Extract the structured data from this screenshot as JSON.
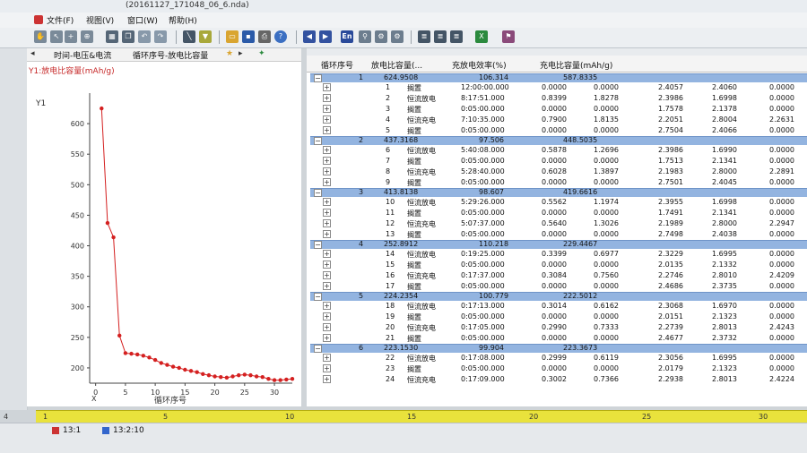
{
  "window": {
    "title": "(20161127_171048_06_6.nda)"
  },
  "menu": [
    "文件(F)",
    "视图(V)",
    "窗口(W)",
    "帮助(H)"
  ],
  "toolbar": {
    "en_label": "En"
  },
  "left_tabs": {
    "tab1": "时间-电压&电流",
    "tab2": "循环序号-放电比容量"
  },
  "chart_data": {
    "type": "scatter",
    "title": "Y1:放电比容量(mAh/g)",
    "ylabel": "Y1",
    "xlabel": "循环序号",
    "x_axis_letter": "X",
    "xticks": [
      0,
      5,
      10,
      15,
      20,
      25,
      30
    ],
    "yticks": [
      200,
      250,
      300,
      350,
      400,
      450,
      500,
      550,
      600
    ],
    "xlim": [
      -1,
      33
    ],
    "ylim": [
      175,
      650
    ],
    "series": [
      {
        "color": "#d42020",
        "x": [
          1,
          2,
          3,
          4,
          5,
          6,
          7,
          8,
          9,
          10,
          11,
          12,
          13,
          14,
          15,
          16,
          17,
          18,
          19,
          20,
          21,
          22,
          23,
          24,
          25,
          26,
          27,
          28,
          29,
          30,
          31,
          32,
          33
        ],
        "y": [
          624.9,
          437.3,
          413.8,
          252.9,
          224.2,
          223.2,
          222,
          220,
          217,
          213,
          208,
          205,
          202,
          200,
          197,
          195,
          193,
          190,
          188,
          186,
          185,
          184,
          186,
          188,
          189,
          188,
          186,
          185,
          182,
          180,
          180,
          181,
          182
        ]
      }
    ]
  },
  "table": {
    "headers": [
      "循环序号",
      "放电比容量(...",
      "充放电效率(%)",
      "充电比容量(mAh/g)"
    ],
    "cycles": [
      {
        "idx": "1",
        "cap": "624.9508",
        "eff": "106.314",
        "chg": "587.8335",
        "steps": [
          {
            "n": "1",
            "name": "搁置",
            "time": "12:00:00.000",
            "c1": "0.0000",
            "c2": "0.0000",
            "c3": "2.4057",
            "c4": "2.4060",
            "c5": "0.0000"
          },
          {
            "n": "2",
            "name": "恒流放电",
            "time": "8:17:51.000",
            "c1": "0.8399",
            "c2": "1.8278",
            "c3": "2.3986",
            "c4": "1.6998",
            "c5": "0.0000"
          },
          {
            "n": "3",
            "name": "搁置",
            "time": "0:05:00.000",
            "c1": "0.0000",
            "c2": "0.0000",
            "c3": "1.7578",
            "c4": "2.1378",
            "c5": "0.0000"
          },
          {
            "n": "4",
            "name": "恒流充电",
            "time": "7:10:35.000",
            "c1": "0.7900",
            "c2": "1.8135",
            "c3": "2.2051",
            "c4": "2.8004",
            "c5": "2.2631"
          },
          {
            "n": "5",
            "name": "搁置",
            "time": "0:05:00.000",
            "c1": "0.0000",
            "c2": "0.0000",
            "c3": "2.7504",
            "c4": "2.4066",
            "c5": "0.0000"
          }
        ]
      },
      {
        "idx": "2",
        "cap": "437.3168",
        "eff": "97.506",
        "chg": "448.5035",
        "steps": [
          {
            "n": "6",
            "name": "恒流放电",
            "time": "5:40:08.000",
            "c1": "0.5878",
            "c2": "1.2696",
            "c3": "2.3986",
            "c4": "1.6990",
            "c5": "0.0000"
          },
          {
            "n": "7",
            "name": "搁置",
            "time": "0:05:00.000",
            "c1": "0.0000",
            "c2": "0.0000",
            "c3": "1.7513",
            "c4": "2.1341",
            "c5": "0.0000"
          },
          {
            "n": "8",
            "name": "恒流充电",
            "time": "5:28:40.000",
            "c1": "0.6028",
            "c2": "1.3897",
            "c3": "2.1983",
            "c4": "2.8000",
            "c5": "2.2891"
          },
          {
            "n": "9",
            "name": "搁置",
            "time": "0:05:00.000",
            "c1": "0.0000",
            "c2": "0.0000",
            "c3": "2.7501",
            "c4": "2.4045",
            "c5": "0.0000"
          }
        ]
      },
      {
        "idx": "3",
        "cap": "413.8138",
        "eff": "98.607",
        "chg": "419.6616",
        "steps": [
          {
            "n": "10",
            "name": "恒流放电",
            "time": "5:29:26.000",
            "c1": "0.5562",
            "c2": "1.1974",
            "c3": "2.3955",
            "c4": "1.6998",
            "c5": "0.0000"
          },
          {
            "n": "11",
            "name": "搁置",
            "time": "0:05:00.000",
            "c1": "0.0000",
            "c2": "0.0000",
            "c3": "1.7491",
            "c4": "2.1341",
            "c5": "0.0000"
          },
          {
            "n": "12",
            "name": "恒流充电",
            "time": "5:07:37.000",
            "c1": "0.5640",
            "c2": "1.3026",
            "c3": "2.1989",
            "c4": "2.8000",
            "c5": "2.2947"
          },
          {
            "n": "13",
            "name": "搁置",
            "time": "0:05:00.000",
            "c1": "0.0000",
            "c2": "0.0000",
            "c3": "2.7498",
            "c4": "2.4038",
            "c5": "0.0000"
          }
        ]
      },
      {
        "idx": "4",
        "cap": "252.8912",
        "eff": "110.218",
        "chg": "229.4467",
        "steps": [
          {
            "n": "14",
            "name": "恒流放电",
            "time": "0:19:25.000",
            "c1": "0.3399",
            "c2": "0.6977",
            "c3": "2.3229",
            "c4": "1.6995",
            "c5": "0.0000"
          },
          {
            "n": "15",
            "name": "搁置",
            "time": "0:05:00.000",
            "c1": "0.0000",
            "c2": "0.0000",
            "c3": "2.0135",
            "c4": "2.1332",
            "c5": "0.0000"
          },
          {
            "n": "16",
            "name": "恒流充电",
            "time": "0:17:37.000",
            "c1": "0.3084",
            "c2": "0.7560",
            "c3": "2.2746",
            "c4": "2.8010",
            "c5": "2.4209"
          },
          {
            "n": "17",
            "name": "搁置",
            "time": "0:05:00.000",
            "c1": "0.0000",
            "c2": "0.0000",
            "c3": "2.4686",
            "c4": "2.3735",
            "c5": "0.0000"
          }
        ]
      },
      {
        "idx": "5",
        "cap": "224.2354",
        "eff": "100.779",
        "chg": "222.5012",
        "steps": [
          {
            "n": "18",
            "name": "恒流放电",
            "time": "0:17:13.000",
            "c1": "0.3014",
            "c2": "0.6162",
            "c3": "2.3068",
            "c4": "1.6970",
            "c5": "0.0000"
          },
          {
            "n": "19",
            "name": "搁置",
            "time": "0:05:00.000",
            "c1": "0.0000",
            "c2": "0.0000",
            "c3": "2.0151",
            "c4": "2.1323",
            "c5": "0.0000"
          },
          {
            "n": "20",
            "name": "恒流充电",
            "time": "0:17:05.000",
            "c1": "0.2990",
            "c2": "0.7333",
            "c3": "2.2739",
            "c4": "2.8013",
            "c5": "2.4243"
          },
          {
            "n": "21",
            "name": "搁置",
            "time": "0:05:00.000",
            "c1": "0.0000",
            "c2": "0.0000",
            "c3": "2.4677",
            "c4": "2.3732",
            "c5": "0.0000"
          }
        ]
      },
      {
        "idx": "6",
        "cap": "223.1530",
        "eff": "99.904",
        "chg": "223.3673",
        "steps": [
          {
            "n": "22",
            "name": "恒流放电",
            "time": "0:17:08.000",
            "c1": "0.2999",
            "c2": "0.6119",
            "c3": "2.3056",
            "c4": "1.6995",
            "c5": "0.0000"
          },
          {
            "n": "23",
            "name": "搁置",
            "time": "0:05:00.000",
            "c1": "0.0000",
            "c2": "0.0000",
            "c3": "2.0179",
            "c4": "2.1323",
            "c5": "0.0000"
          },
          {
            "n": "24",
            "name": "恒流充电",
            "time": "0:17:09.000",
            "c1": "0.3002",
            "c2": "0.7366",
            "c3": "2.2938",
            "c4": "2.8013",
            "c5": "2.4224"
          }
        ]
      }
    ]
  },
  "ruler": {
    "left_num": "4",
    "ticks": [
      "1",
      "5",
      "10",
      "15",
      "20",
      "25",
      "30"
    ]
  },
  "status": {
    "item1": "13:1",
    "item2": "13:2:10"
  }
}
